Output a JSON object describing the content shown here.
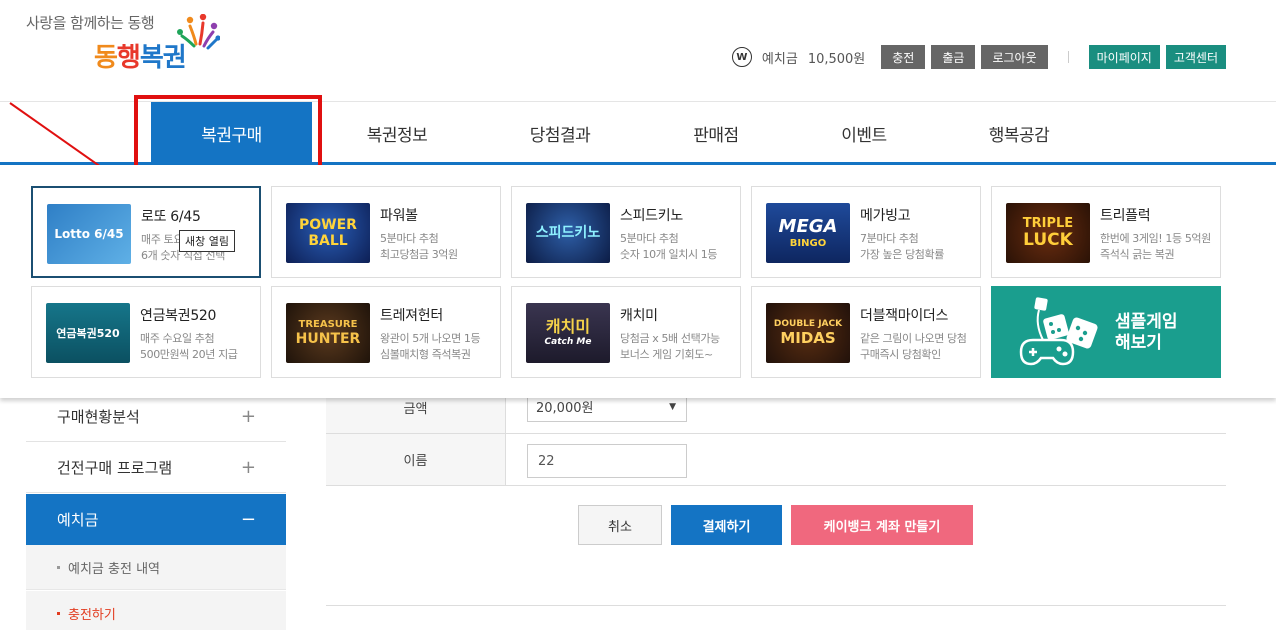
{
  "brand": {
    "slogan": "사랑을 함께하는 동행",
    "name_part1": "동",
    "name_part2": "행",
    "name_part3": "복권",
    "colors": {
      "orange": "#f08a1c",
      "red": "#e8382b",
      "blue": "#1f77c9"
    }
  },
  "topbar": {
    "balance_icon": "W",
    "balance_label": "예치금",
    "balance_value": "10,500원",
    "charge": "충전",
    "withdraw": "출금",
    "logout": "로그아웃",
    "mypage": "마이페이지",
    "support": "고객센터"
  },
  "nav": {
    "items": [
      "복권구매",
      "복권정보",
      "당첨결과",
      "판매점",
      "이벤트",
      "행복공감"
    ],
    "active_index": 0
  },
  "mega_menu": {
    "tooltip": "새창 열림",
    "cards": [
      {
        "title": "로또 6/45",
        "desc1": "매주 토요일 추첨",
        "desc2": "6개 숫자 직접 선택",
        "thumb": "Lotto 6/45",
        "icon": "lotto-logo"
      },
      {
        "title": "파워볼",
        "desc1": "5분마다 추첨",
        "desc2": "최고당첨금 3억원",
        "thumb1": "POWER",
        "thumb2": "BALL",
        "icon": "powerball-logo"
      },
      {
        "title": "스피드키노",
        "desc1": "5분마다 추첨",
        "desc2": "숫자 10개 일치시 1등",
        "thumb": "스피드키노",
        "icon": "speedkeno-logo"
      },
      {
        "title": "메가빙고",
        "desc1": "7분마다 추첨",
        "desc2": "가장 높은 당첨확률",
        "thumb1": "MEGA",
        "thumb2": "BINGO",
        "icon": "megabingo-logo"
      },
      {
        "title": "트리플럭",
        "desc1": "한번에 3게임! 1등 5억원",
        "desc2": "즉석식 긁는 복권",
        "thumb1": "TRIPLE",
        "thumb2": "LUCK",
        "icon": "tripleluck-logo"
      },
      {
        "title": "연금복권520",
        "desc1": "매주 수요일 추첨",
        "desc2": "500만원씩 20년 지급",
        "thumb": "연금복권520",
        "icon": "pension-lottery-logo"
      },
      {
        "title": "트레져헌터",
        "desc1": "왕관이 5개 나오면 1등",
        "desc2": "심볼매치형 즉석복권",
        "thumb1": "TREASURE",
        "thumb2": "HUNTER",
        "icon": "treasure-hunter-logo"
      },
      {
        "title": "캐치미",
        "desc1": "당첨금 x 5배 선택가능",
        "desc2": "보너스 게임 기회도~",
        "thumb1": "캐치미",
        "thumb2": "Catch Me",
        "icon": "catchme-logo"
      },
      {
        "title": "더블잭마이더스",
        "desc1": "같은 그림이 나오면 당첨",
        "desc2": "구매즉시 당첨확인",
        "thumb1": "DOUBLE JACK",
        "thumb2": "MIDAS",
        "icon": "doublejack-logo"
      }
    ],
    "sample": {
      "label": "샘플게임\n해보기",
      "icon": "dice-gamepad-icon",
      "color": "#1a9e8e"
    }
  },
  "sidebar": {
    "items": [
      {
        "label": "구매현황분석",
        "sign": "+"
      },
      {
        "label": "건전구매 프로그램",
        "sign": "+"
      },
      {
        "label": "예치금",
        "sign": "−"
      }
    ],
    "sub_items": [
      "예치금 충전 내역",
      "충전하기"
    ]
  },
  "form": {
    "amount_label": "금액",
    "amount_value": "20,000원",
    "name_label": "이름",
    "name_value": "22",
    "cancel": "취소",
    "pay": "결제하기",
    "kbank": "케이뱅크 계좌 만들기"
  },
  "colors": {
    "primary": "#1474c4",
    "teal": "#1a8e80",
    "highlight_red": "#e01010",
    "pink": "#f0687e"
  }
}
